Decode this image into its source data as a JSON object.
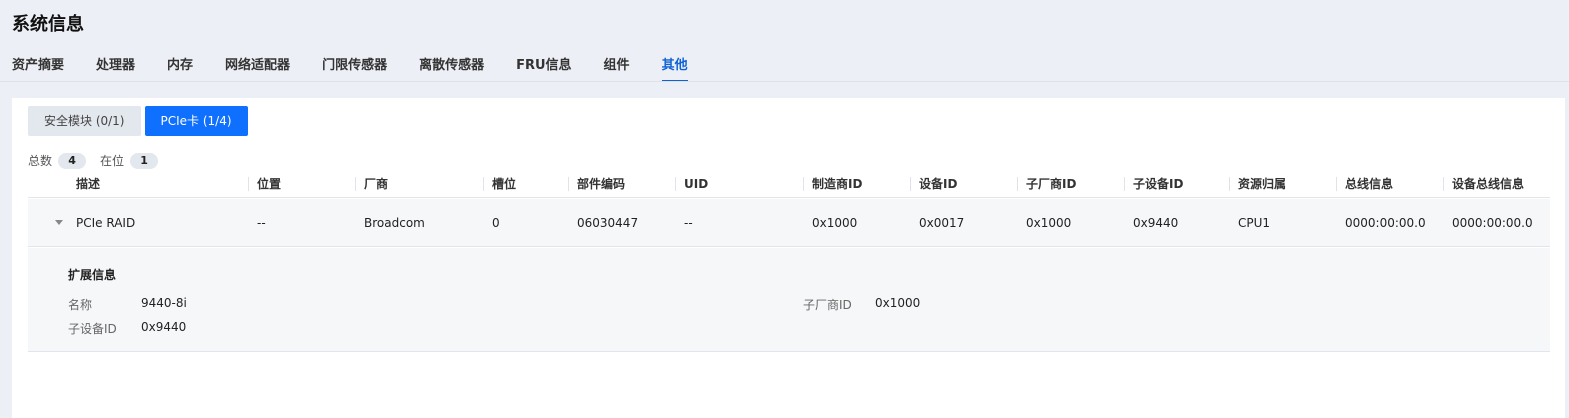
{
  "page": {
    "title": "系统信息"
  },
  "tabs": [
    {
      "label": "资产摘要"
    },
    {
      "label": "处理器"
    },
    {
      "label": "内存"
    },
    {
      "label": "网络适配器"
    },
    {
      "label": "门限传感器"
    },
    {
      "label": "离散传感器"
    },
    {
      "label": "FRU信息"
    },
    {
      "label": "组件"
    },
    {
      "label": "其他",
      "active": true
    }
  ],
  "subtabs": [
    {
      "label": "安全模块 (0/1)"
    },
    {
      "label": "PCIe卡 (1/4)",
      "active": true
    }
  ],
  "counts": {
    "total_label": "总数",
    "total_value": "4",
    "present_label": "在位",
    "present_value": "1"
  },
  "table": {
    "columns": [
      "描述",
      "位置",
      "厂商",
      "槽位",
      "部件编码",
      "UID",
      "制造商ID",
      "设备ID",
      "子厂商ID",
      "子设备ID",
      "资源归属",
      "总线信息",
      "设备总线信息"
    ],
    "rows": [
      [
        "PCIe RAID",
        "--",
        "Broadcom",
        "0",
        "06030447",
        "--",
        "0x1000",
        "0x0017",
        "0x1000",
        "0x9440",
        "CPU1",
        "0000:00:00.0",
        "0000:00:00.0"
      ]
    ]
  },
  "expanded": {
    "title": "扩展信息",
    "name_label": "名称",
    "name_value": "9440-8i",
    "subvendor_label": "子厂商ID",
    "subvendor_value": "0x1000",
    "subdevice_label": "子设备ID",
    "subdevice_value": "0x9440"
  },
  "colors": {
    "accent": "#0f62d6",
    "button_active": "#0f6fff",
    "background": "#eceff5"
  }
}
